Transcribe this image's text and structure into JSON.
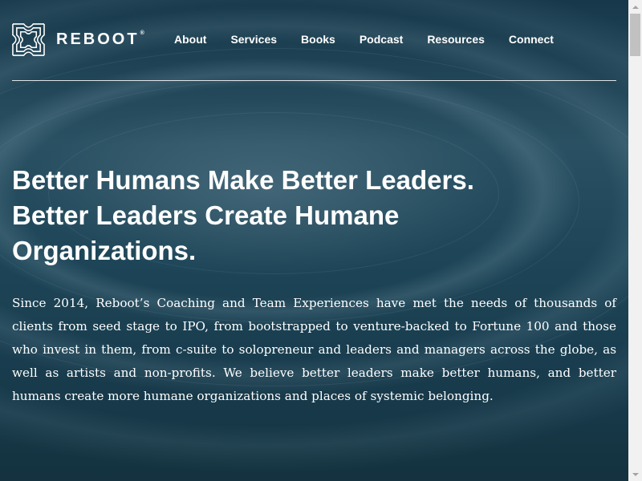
{
  "brand": {
    "name": "REBOOT",
    "mark": "®",
    "logo_icon": "reboot-logo-icon"
  },
  "nav": {
    "items": [
      {
        "label": "About"
      },
      {
        "label": "Services"
      },
      {
        "label": "Books"
      },
      {
        "label": "Podcast"
      },
      {
        "label": "Resources"
      },
      {
        "label": "Connect"
      }
    ]
  },
  "hero": {
    "headline_lines": [
      "Better Humans Make Better Leaders.",
      "Better Leaders Create Humane",
      "Organizations."
    ],
    "intro": "Since 2014, Reboot’s Coaching and Team Experiences have met the needs of thousands of clients from seed stage to IPO, from bootstrapped to venture-backed to Fortune 100 and those who invest in them, from c-suite to solopreneur and leaders and managers across the globe, as well as artists and non-profits. We believe better leaders make better humans, and better humans create more humane organizations and places of systemic belonging."
  },
  "colors": {
    "text": "#ffffff",
    "background": "#1b3a4b",
    "scrollbar": "#f1f1f1"
  }
}
